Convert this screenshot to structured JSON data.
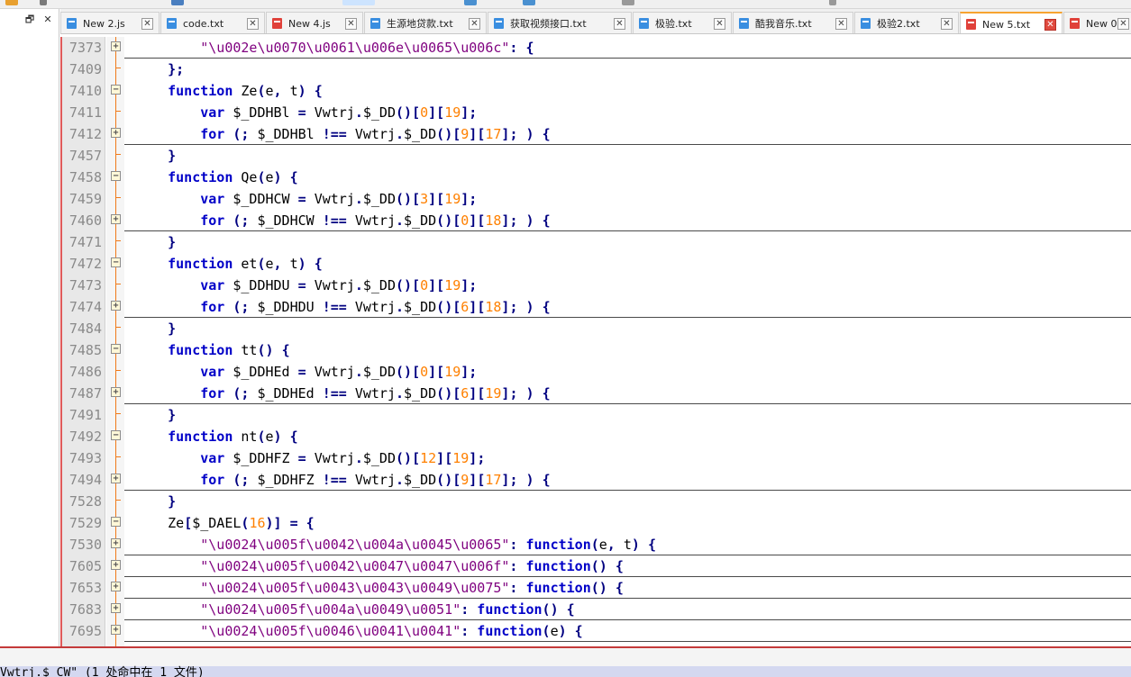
{
  "side_panel": {
    "restore_icon": "restore-window-icon",
    "close_symbol": "✕"
  },
  "tabs": [
    {
      "label": "New 2.js",
      "state": "saved",
      "active": false
    },
    {
      "label": "code.txt",
      "state": "saved",
      "active": false
    },
    {
      "label": "New 4.js",
      "state": "unsaved",
      "active": false
    },
    {
      "label": "生源地贷款.txt",
      "state": "saved",
      "active": false
    },
    {
      "label": "获取视频接口.txt",
      "state": "saved",
      "active": false
    },
    {
      "label": "极验.txt",
      "state": "saved",
      "active": false
    },
    {
      "label": "酷我音乐.txt",
      "state": "saved",
      "active": false
    },
    {
      "label": "极验2.txt",
      "state": "saved",
      "active": false
    },
    {
      "label": "New 5.txt",
      "state": "unsaved",
      "active": true
    },
    {
      "label": "New 0",
      "state": "unsaved",
      "active": false
    }
  ],
  "tab_close_symbol": "✕",
  "colors": {
    "keyword": "#0000c8",
    "string": "#7f007f",
    "number": "#ff8000",
    "fold_line": "#f07a1a",
    "active_tab_accent": "#f7a330"
  },
  "lines": [
    {
      "num": "7373",
      "fold": "plus",
      "folded": true,
      "code": "        \"\\u002e\\u0070\\u0061\\u006e\\u0065\\u006c\": {"
    },
    {
      "num": "7409",
      "fold": "tick",
      "folded": false,
      "code": "    };"
    },
    {
      "num": "7410",
      "fold": "minus",
      "folded": false,
      "code": "    function Ze(e, t) {"
    },
    {
      "num": "7411",
      "fold": "tick",
      "folded": false,
      "code": "        var $_DDHBl = Vwtrj.$_DD()[0][19];"
    },
    {
      "num": "7412",
      "fold": "plus",
      "folded": true,
      "code": "        for (; $_DDHBl !== Vwtrj.$_DD()[9][17]; ) {"
    },
    {
      "num": "7457",
      "fold": "tick",
      "folded": false,
      "code": "    }"
    },
    {
      "num": "7458",
      "fold": "minus",
      "folded": false,
      "code": "    function Qe(e) {"
    },
    {
      "num": "7459",
      "fold": "tick",
      "folded": false,
      "code": "        var $_DDHCW = Vwtrj.$_DD()[3][19];"
    },
    {
      "num": "7460",
      "fold": "plus",
      "folded": true,
      "code": "        for (; $_DDHCW !== Vwtrj.$_DD()[0][18]; ) {"
    },
    {
      "num": "7471",
      "fold": "tick",
      "folded": false,
      "code": "    }"
    },
    {
      "num": "7472",
      "fold": "minus",
      "folded": false,
      "code": "    function et(e, t) {"
    },
    {
      "num": "7473",
      "fold": "tick",
      "folded": false,
      "code": "        var $_DDHDU = Vwtrj.$_DD()[0][19];"
    },
    {
      "num": "7474",
      "fold": "plus",
      "folded": true,
      "code": "        for (; $_DDHDU !== Vwtrj.$_DD()[6][18]; ) {"
    },
    {
      "num": "7484",
      "fold": "tick",
      "folded": false,
      "code": "    }"
    },
    {
      "num": "7485",
      "fold": "minus",
      "folded": false,
      "code": "    function tt() {"
    },
    {
      "num": "7486",
      "fold": "tick",
      "folded": false,
      "code": "        var $_DDHEd = Vwtrj.$_DD()[0][19];"
    },
    {
      "num": "7487",
      "fold": "plus",
      "folded": true,
      "code": "        for (; $_DDHEd !== Vwtrj.$_DD()[6][19]; ) {"
    },
    {
      "num": "7491",
      "fold": "tick",
      "folded": false,
      "code": "    }"
    },
    {
      "num": "7492",
      "fold": "minus",
      "folded": false,
      "code": "    function nt(e) {"
    },
    {
      "num": "7493",
      "fold": "tick",
      "folded": false,
      "code": "        var $_DDHFZ = Vwtrj.$_DD()[12][19];"
    },
    {
      "num": "7494",
      "fold": "plus",
      "folded": true,
      "code": "        for (; $_DDHFZ !== Vwtrj.$_DD()[9][17]; ) {"
    },
    {
      "num": "7528",
      "fold": "tick",
      "folded": false,
      "code": "    }"
    },
    {
      "num": "7529",
      "fold": "minus",
      "folded": false,
      "code": "    Ze[$_DAEL(16)] = {"
    },
    {
      "num": "7530",
      "fold": "plus",
      "folded": true,
      "code": "        \"\\u0024\\u005f\\u0042\\u004a\\u0045\\u0065\": function(e, t) {"
    },
    {
      "num": "7605",
      "fold": "plus",
      "folded": true,
      "code": "        \"\\u0024\\u005f\\u0042\\u0047\\u0047\\u006f\": function() {"
    },
    {
      "num": "7653",
      "fold": "plus",
      "folded": true,
      "code": "        \"\\u0024\\u005f\\u0043\\u0043\\u0049\\u0075\": function() {"
    },
    {
      "num": "7683",
      "fold": "plus",
      "folded": true,
      "code": "        \"\\u0024\\u005f\\u004a\\u0049\\u0051\": function() {"
    },
    {
      "num": "7695",
      "fold": "plus",
      "folded": true,
      "code": "        \"\\u0024\\u005f\\u0046\\u0041\\u0041\": function(e) {"
    }
  ],
  "find_results": {
    "header": " Vwtrj.$_CW\" (1 处命中在 1 文件)"
  }
}
